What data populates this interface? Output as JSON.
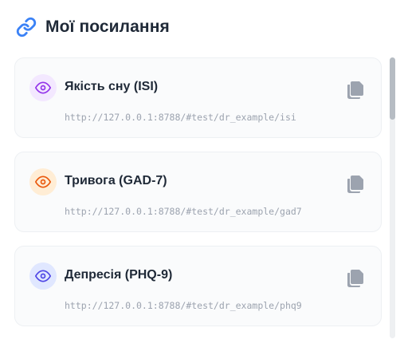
{
  "header": {
    "title": "Мої посилання",
    "icon": "link-icon",
    "icon_color": "#3b82f6"
  },
  "links": [
    {
      "title": "Якість сну (ISI)",
      "url": "http://127.0.0.1:8788/#test/dr_example/isi",
      "icon": "eye-icon",
      "color": "#9333ea",
      "bg": "#f3e8ff"
    },
    {
      "title": "Тривога (GAD-7)",
      "url": "http://127.0.0.1:8788/#test/dr_example/gad7",
      "icon": "eye-icon",
      "color": "#ea580c",
      "bg": "#ffedd5"
    },
    {
      "title": "Депресія (PHQ-9)",
      "url": "http://127.0.0.1:8788/#test/dr_example/phq9",
      "icon": "eye-icon",
      "color": "#4f46e5",
      "bg": "#e0e7ff"
    }
  ],
  "copy_icon": "copy-icon",
  "copy_color": "#9ca3af"
}
